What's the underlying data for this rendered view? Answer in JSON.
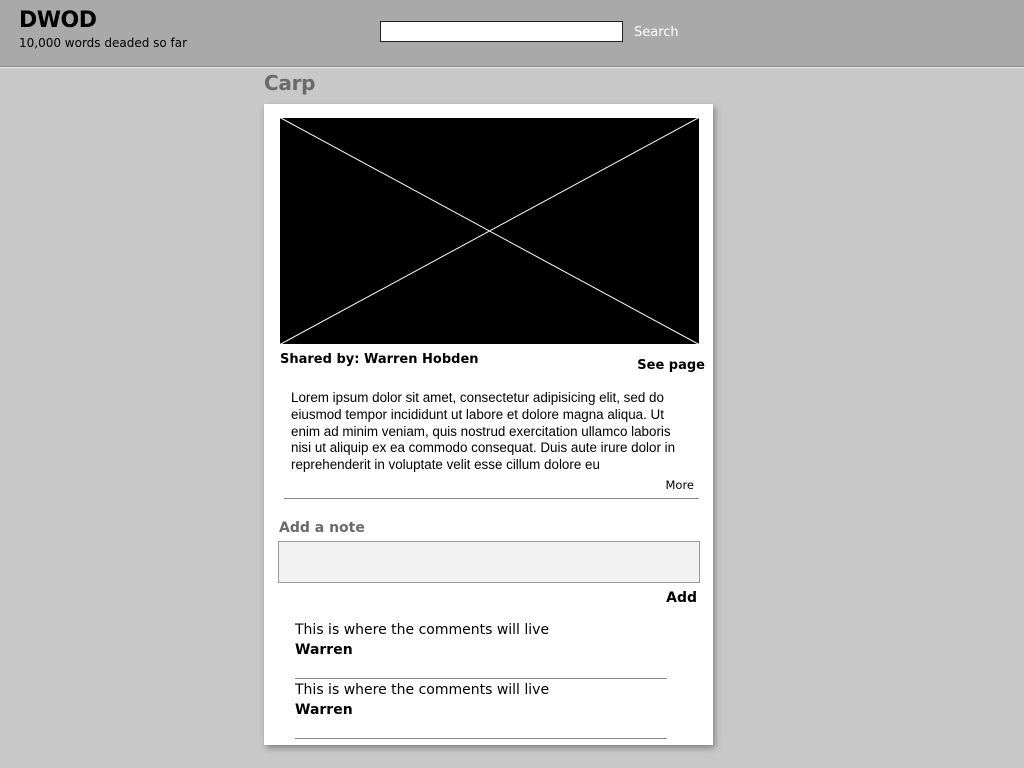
{
  "header": {
    "brand": "DWOD",
    "tagline": "10,000 words deaded so far",
    "search_value": "",
    "search_label": "Search"
  },
  "page": {
    "title": "Carp"
  },
  "card": {
    "image_icon": "image-placeholder-icon",
    "shared_by": "Shared by: Warren Hobden",
    "see_page": "See page",
    "description": "Lorem ipsum dolor sit amet, consectetur adipisicing elit, sed do eiusmod tempor incididunt ut labore et dolore magna aliqua. Ut enim ad minim veniam, quis nostrud exercitation ullamco laboris nisi ut aliquip ex ea commodo consequat. Duis aute irure dolor in reprehenderit in voluptate velit esse cillum dolore eu",
    "more": "More"
  },
  "notes": {
    "heading": "Add a note",
    "input_value": "",
    "add_label": "Add"
  },
  "comments": [
    {
      "text": "This is where the comments will live",
      "author": "Warren"
    },
    {
      "text": "This is where the comments will live",
      "author": "Warren"
    }
  ],
  "colors": {
    "background": "#c8c8c8",
    "header": "#a9a9a9",
    "card": "#ffffff",
    "muted_heading": "#6a6a6a",
    "note_field": "#f2f2f2"
  }
}
